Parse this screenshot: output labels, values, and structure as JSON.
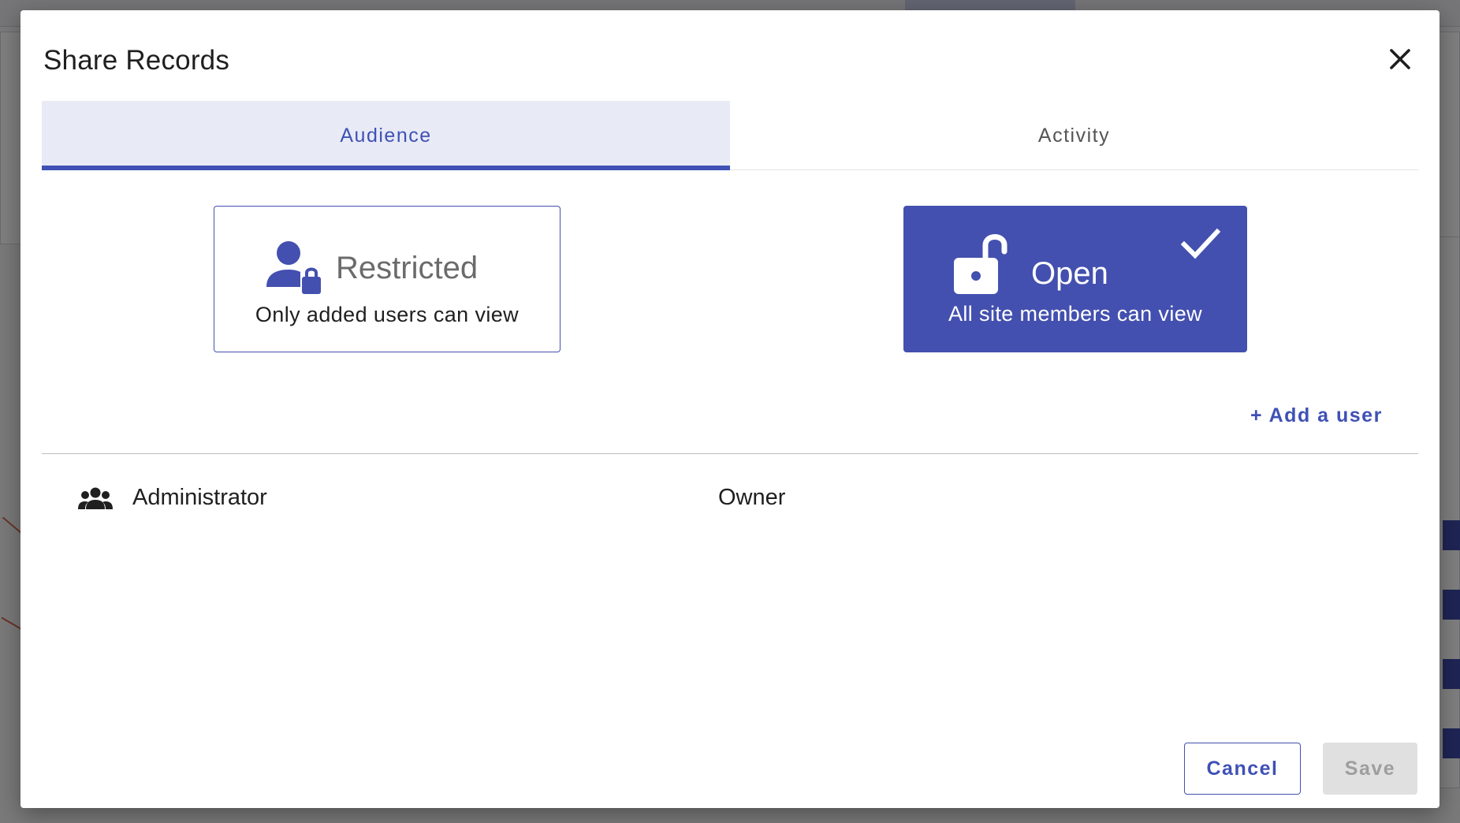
{
  "dialog": {
    "title": "Share Records",
    "close_label": "close"
  },
  "tabs": [
    {
      "label": "Audience",
      "active": true
    },
    {
      "label": "Activity",
      "active": false
    }
  ],
  "audience_options": {
    "restricted": {
      "title": "Restricted",
      "subtitle": "Only added users can view",
      "selected": false,
      "icon": "user-lock-icon"
    },
    "open": {
      "title": "Open",
      "subtitle": "All site members can view",
      "selected": true,
      "icon": "lock-open-icon"
    }
  },
  "add_user_label": "+ Add a user",
  "members": [
    {
      "name": "Administrator",
      "role": "Owner",
      "icon": "group-icon"
    }
  ],
  "actions": {
    "cancel_label": "Cancel",
    "save_label": "Save"
  },
  "colors": {
    "primary": "#3f51b5",
    "selected_fill": "#4350af",
    "tab_active_bg": "#e8eaf6",
    "disabled_bg": "#e0e0e0",
    "disabled_text": "#9e9e9e"
  }
}
